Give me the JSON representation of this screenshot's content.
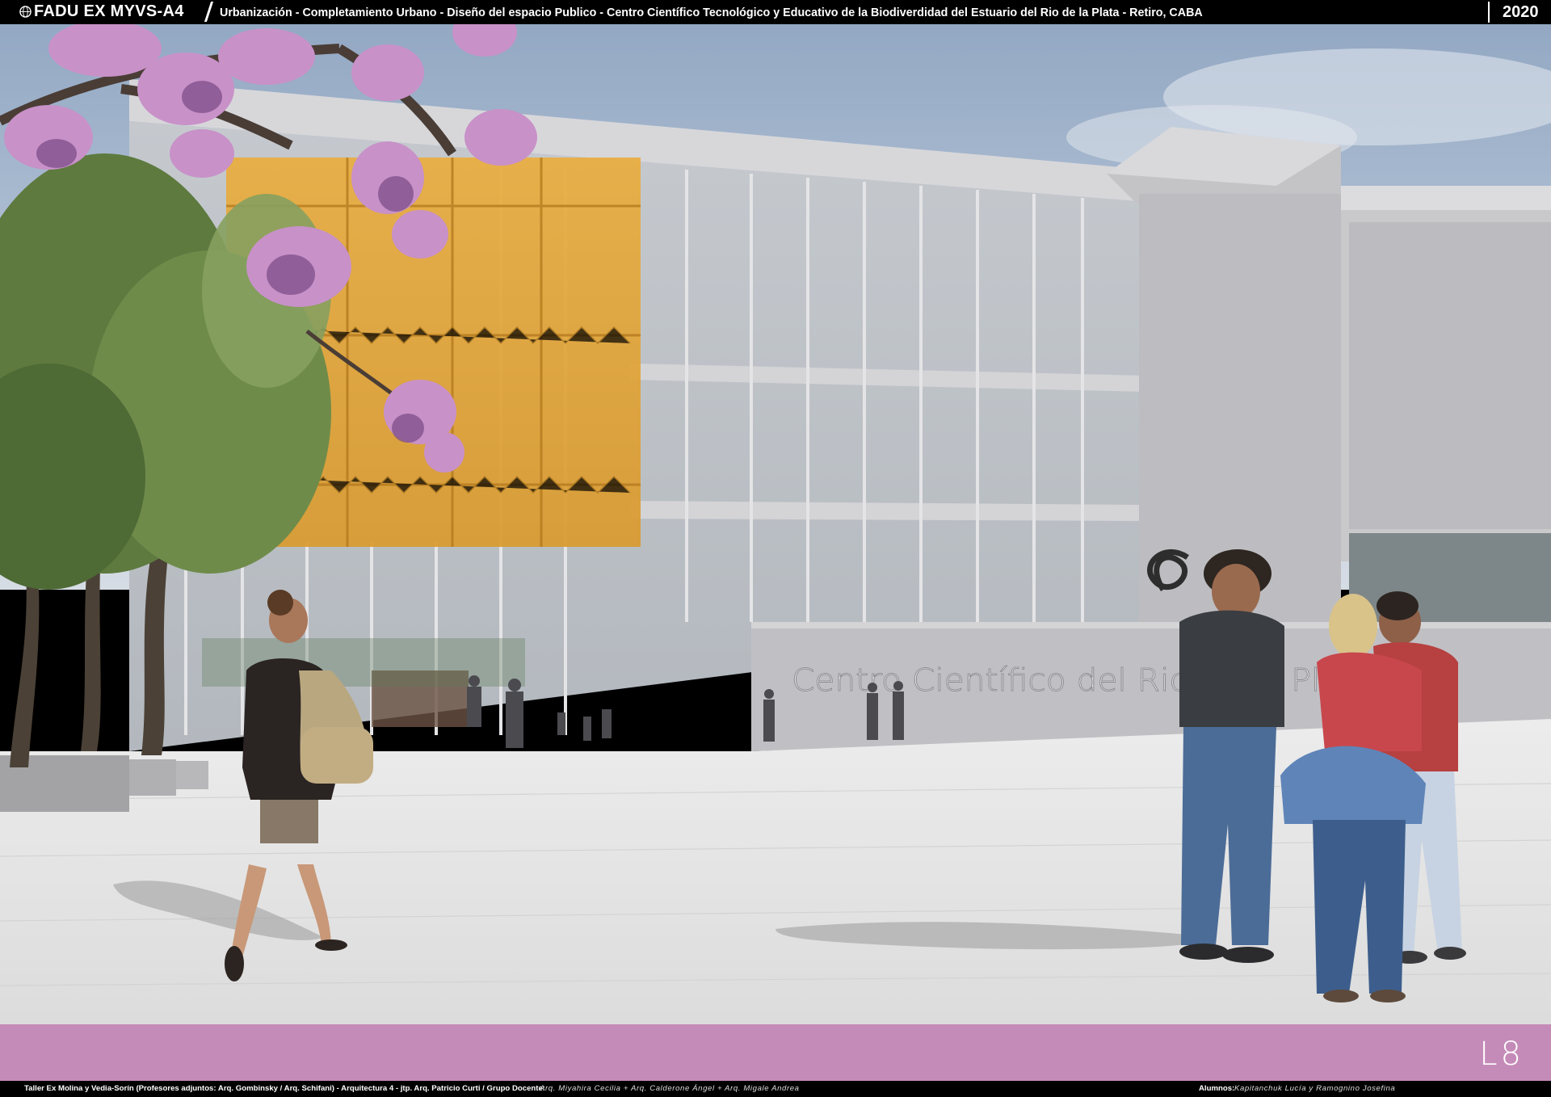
{
  "header": {
    "logo_icon": "globe-icon",
    "code": "FADU EX MYVS-A4",
    "title": "Urbanización - Completamiento Urbano - Diseño del espacio Publico - Centro Científico Tecnológico y Educativo de la Biodiverdidad del Estuario del Rio de la Plata   - Retiro, CABA",
    "year": "2020"
  },
  "scene": {
    "wall_sign": "Centro Científico del Rio de la Plata"
  },
  "band": {
    "color": "#c58bb8",
    "sheet_number": "L8"
  },
  "footer": {
    "taller": "Taller Ex Molina y Vedia-Sorín (Profesores adjuntos:  Arq. Gombinsky / Arq. Schifani) - Arquitectura 4 - jtp. Arq. Patricio Curti / Grupo Docente:",
    "docentes": "Arq. Miyahira Cecilia  +  Arq. Calderone Ángel  +  Arq. Migale Andrea",
    "alumnos_label": "Alumnos:",
    "alumnos": "Kapitanchuk Lucía  y  Ramognino Josefina"
  },
  "colors": {
    "sky": "#aebfd4",
    "building": "#cfcfd2",
    "orange_volume": "#e0a53a",
    "blossom": "#c88fc6",
    "plaza": "#e3e3e3"
  }
}
